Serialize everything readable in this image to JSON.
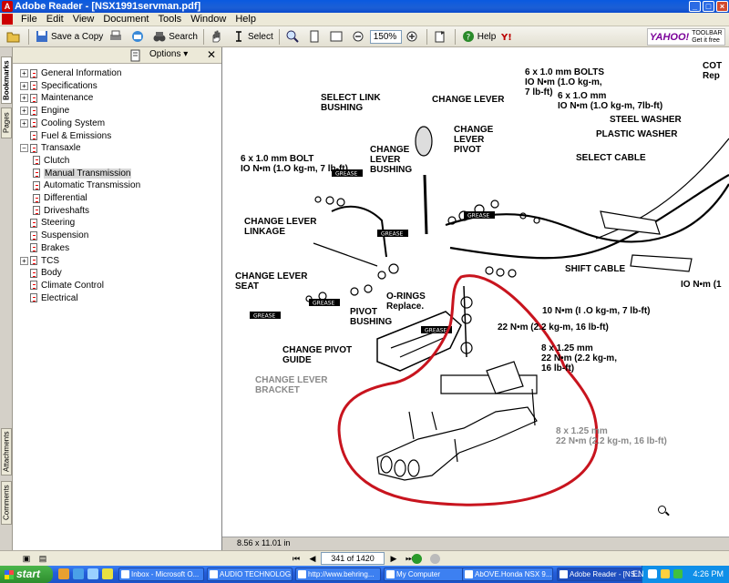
{
  "window": {
    "title": "Adobe Reader - [NSX1991servman.pdf]",
    "controls": [
      "_",
      "□",
      "×"
    ]
  },
  "menu": [
    "File",
    "Edit",
    "View",
    "Document",
    "Tools",
    "Window",
    "Help"
  ],
  "toolbar": {
    "save_copy": "Save a Copy",
    "search": "Search",
    "select": "Select",
    "zoom": "150%",
    "help": "Help",
    "yahoo_brand": "YAHOO!",
    "yahoo_l1": "TOOLBAR",
    "yahoo_l2": "Get it free"
  },
  "side_tabs": [
    "Bookmarks",
    "Pages",
    "Attachments",
    "Comments"
  ],
  "panel": {
    "options": "Options",
    "bookmarks": [
      {
        "label": "General Information",
        "expandable": true
      },
      {
        "label": "Specifications",
        "expandable": true
      },
      {
        "label": "Maintenance",
        "expandable": true
      },
      {
        "label": "Engine",
        "expandable": true
      },
      {
        "label": "Cooling System",
        "expandable": true
      },
      {
        "label": "Fuel & Emissions",
        "expandable": false
      },
      {
        "label": "Transaxle",
        "expandable": true,
        "expanded": true
      },
      {
        "label": "Clutch",
        "child": true
      },
      {
        "label": "Manual Transmission",
        "child": true,
        "selected": true
      },
      {
        "label": "Automatic Transmission",
        "child": true
      },
      {
        "label": "Differential",
        "child": true
      },
      {
        "label": "Driveshafts",
        "child": true
      },
      {
        "label": "Steering",
        "expandable": false
      },
      {
        "label": "Suspension",
        "expandable": false
      },
      {
        "label": "Brakes",
        "expandable": false
      },
      {
        "label": "TCS",
        "expandable": true
      },
      {
        "label": "Body",
        "expandable": false
      },
      {
        "label": "Climate Control",
        "expandable": false
      },
      {
        "label": "Electrical",
        "expandable": false
      }
    ]
  },
  "diagram": {
    "labels": {
      "select_link": "SELECT LINK\nBUSHING",
      "change_lever": "CHANGE LEVER",
      "change_lever_pivot": "CHANGE\nLEVER\nPIVOT",
      "change_lever_bushing": "CHANGE\nLEVER\nBUSHING",
      "bolt_6x10": "6 x 1.0 mm BOLT\nIO N•m (1.O kg-m, 7 lb-ft)",
      "bolts_6x10": "6 x 1.0 mm BOLTS\nIO N•m (1.O kg-m,\n7 lb-ft)",
      "bolt_6x10_b": "6 x 1.O mm\nIO N•m (1.O kg-m, 7lb-ft)",
      "cotter": "COT\nRep",
      "steel_washer": "STEEL WASHER",
      "plastic_washer": "PLASTIC WASHER",
      "select_cable": "SELECT CABLE",
      "linkage": "CHANGE LEVER\nLINKAGE",
      "seat": "CHANGE LEVER\nSEAT",
      "o_rings": "O-RINGS\nReplace.",
      "pivot_bushing": "PIVOT\nBUSHING",
      "pivot_guide": "CHANGE PIVOT\nGUIDE",
      "shift_cable": "SHIFT CABLE",
      "torque_10": "10 N•m (I .O kg-m, 7 lb-ft)",
      "torque_22": "22 N•m (2.2 kg-m, 16 lb-ft)",
      "bolt_8x125": "8 x 1.25 mm\n22 N•m (2.2 kg-m,\n16 lb-ft)",
      "bracket": "CHANGE LEVER\nBRACKET",
      "bolt_8x125_b": "8 x 1.25 mm\n22 N•m (2.2 kg-m, 16 lb-ft)",
      "right_torque": "IO N•m (1",
      "grease": "GREASE"
    },
    "colors": {
      "circle": "#c8141e",
      "ink": "#000000"
    }
  },
  "page_size": "8.56 x 11.01 in",
  "nav": {
    "page": "341 of 1420"
  },
  "taskbar": {
    "start": "start",
    "tasks": [
      "Inbox - Microsoft O...",
      "AUDIO TECHNOLOG...",
      "http://www.behring...",
      "My Computer",
      "AbOVE.Honda NSX 9...",
      "Adobe Reader - [NS..."
    ],
    "lang": "EN",
    "clock": "4:26 PM"
  }
}
